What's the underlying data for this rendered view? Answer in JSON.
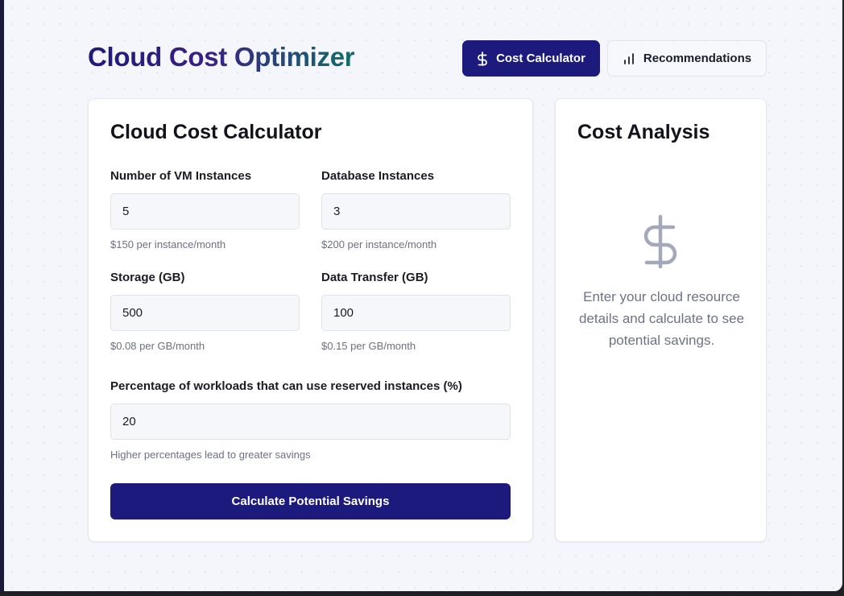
{
  "header": {
    "app_title": "Cloud Cost Optimizer",
    "nav": [
      {
        "label": "Cost Calculator",
        "icon": "dollar-icon",
        "active": true
      },
      {
        "label": "Recommendations",
        "icon": "bar-chart-icon",
        "active": false
      }
    ]
  },
  "calculator": {
    "title": "Cloud Cost Calculator",
    "fields": [
      {
        "label": "Number of VM Instances",
        "value": "5",
        "hint": "$150 per instance/month"
      },
      {
        "label": "Database Instances",
        "value": "3",
        "hint": "$200 per instance/month"
      },
      {
        "label": "Storage (GB)",
        "value": "500",
        "hint": "$0.08 per GB/month"
      },
      {
        "label": "Data Transfer (GB)",
        "value": "100",
        "hint": "$0.15 per GB/month"
      },
      {
        "label": "Percentage of workloads that can use reserved instances (%)",
        "value": "20",
        "hint": "Higher percentages lead to greater savings"
      }
    ],
    "submit_label": "Calculate Potential Savings"
  },
  "analysis": {
    "title": "Cost Analysis",
    "icon": "dollar-icon",
    "empty_message": "Enter your cloud resource details and calculate to see potential savings."
  },
  "colors": {
    "primary": "#1c1a7c",
    "title_gradient_start": "#1e1b7a",
    "title_gradient_end": "#0f6f6a",
    "muted_text": "#6b7384",
    "background": "#f5f6fb"
  }
}
